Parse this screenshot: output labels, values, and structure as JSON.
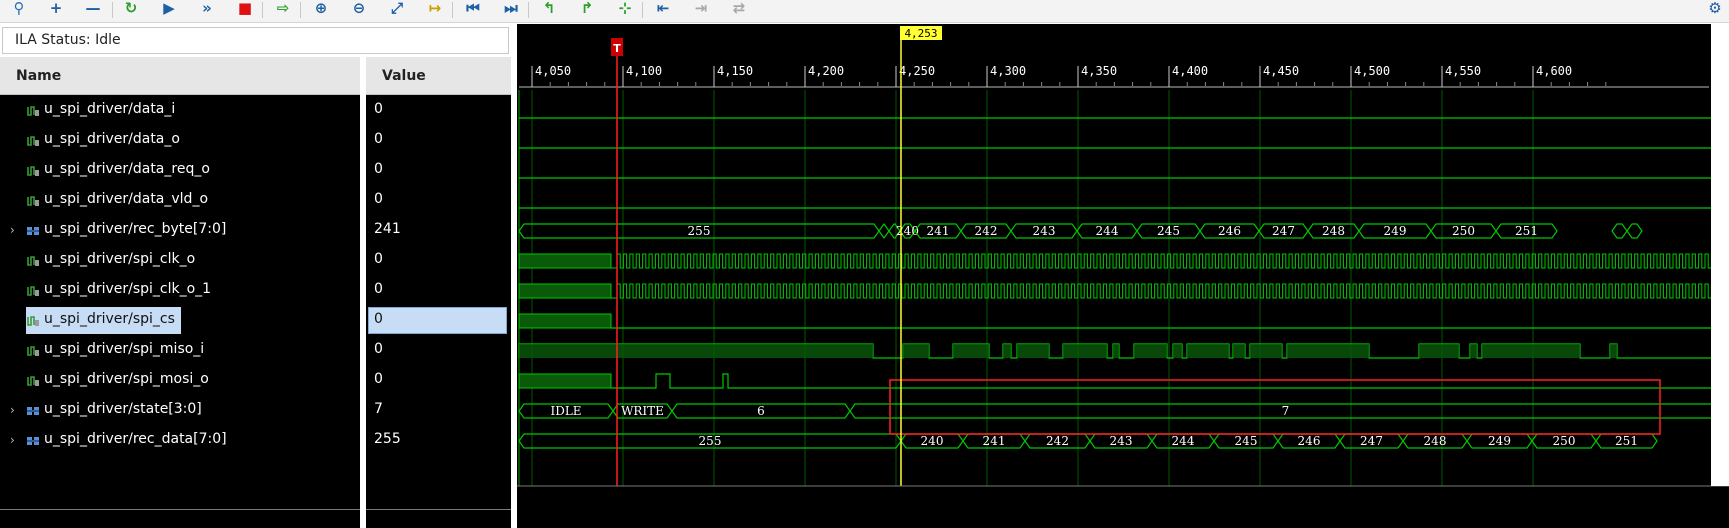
{
  "toolbar": {
    "buttons": [
      "search-icon",
      "add-icon",
      "remove-icon",
      "refresh-icon",
      "run-icon",
      "run-all-icon",
      "stop-icon",
      "export-icon",
      "zoom-in-icon",
      "zoom-out-icon",
      "zoom-fit-icon",
      "go-to-cursor-icon",
      "go-to-start-icon",
      "go-to-end-icon",
      "previous-transition-icon",
      "next-transition-icon",
      "add-marker-icon",
      "previous-marker-icon",
      "next-marker-icon",
      "swap-markers-icon",
      "settings-icon"
    ]
  },
  "status": {
    "label": "ILA Status:",
    "value": "Idle"
  },
  "columns": {
    "name": "Name",
    "value": "Value"
  },
  "signals": [
    {
      "name": "u_spi_driver/data_i",
      "value": "0",
      "bus": false
    },
    {
      "name": "u_spi_driver/data_o",
      "value": "0",
      "bus": false
    },
    {
      "name": "u_spi_driver/data_req_o",
      "value": "0",
      "bus": false
    },
    {
      "name": "u_spi_driver/data_vld_o",
      "value": "0",
      "bus": false
    },
    {
      "name": "u_spi_driver/rec_byte[7:0]",
      "value": "241",
      "bus": true
    },
    {
      "name": "u_spi_driver/spi_clk_o",
      "value": "0",
      "bus": false
    },
    {
      "name": "u_spi_driver/spi_clk_o_1",
      "value": "0",
      "bus": false
    },
    {
      "name": "u_spi_driver/spi_cs",
      "value": "0",
      "bus": false,
      "selected": true
    },
    {
      "name": "u_spi_driver/spi_miso_i",
      "value": "0",
      "bus": false
    },
    {
      "name": "u_spi_driver/spi_mosi_o",
      "value": "0",
      "bus": false
    },
    {
      "name": "u_spi_driver/state[3:0]",
      "value": "7",
      "bus": true
    },
    {
      "name": "u_spi_driver/rec_data[7:0]",
      "value": "255",
      "bus": true
    }
  ],
  "timeline": {
    "ticks": [
      "4,050",
      "4,100",
      "4,150",
      "4,200",
      "4,250",
      "4,300",
      "4,350",
      "4,400",
      "4,450",
      "4,500",
      "4,550",
      "4,600"
    ],
    "cursor_value": "4,253",
    "trigger_label": "T"
  },
  "waveforms": {
    "rec_byte": {
      "initial": "255",
      "values": [
        "240",
        "241",
        "242",
        "243",
        "244",
        "245",
        "246",
        "247",
        "248",
        "249",
        "250",
        "251"
      ]
    },
    "state": {
      "values": [
        "IDLE",
        "WRITE",
        "6",
        "7"
      ]
    },
    "rec_data": {
      "initial": "255",
      "values": [
        "240",
        "241",
        "242",
        "243",
        "244",
        "245",
        "246",
        "247",
        "248",
        "249",
        "250",
        "251"
      ]
    }
  },
  "colors": {
    "wave": "#00c800",
    "grid": "#00a000",
    "trigger": "#ff2020",
    "cursor": "#ffff33",
    "highlight": "#ff2020",
    "bus_text": "#ffffff",
    "ruler_text": "#ffffff"
  }
}
